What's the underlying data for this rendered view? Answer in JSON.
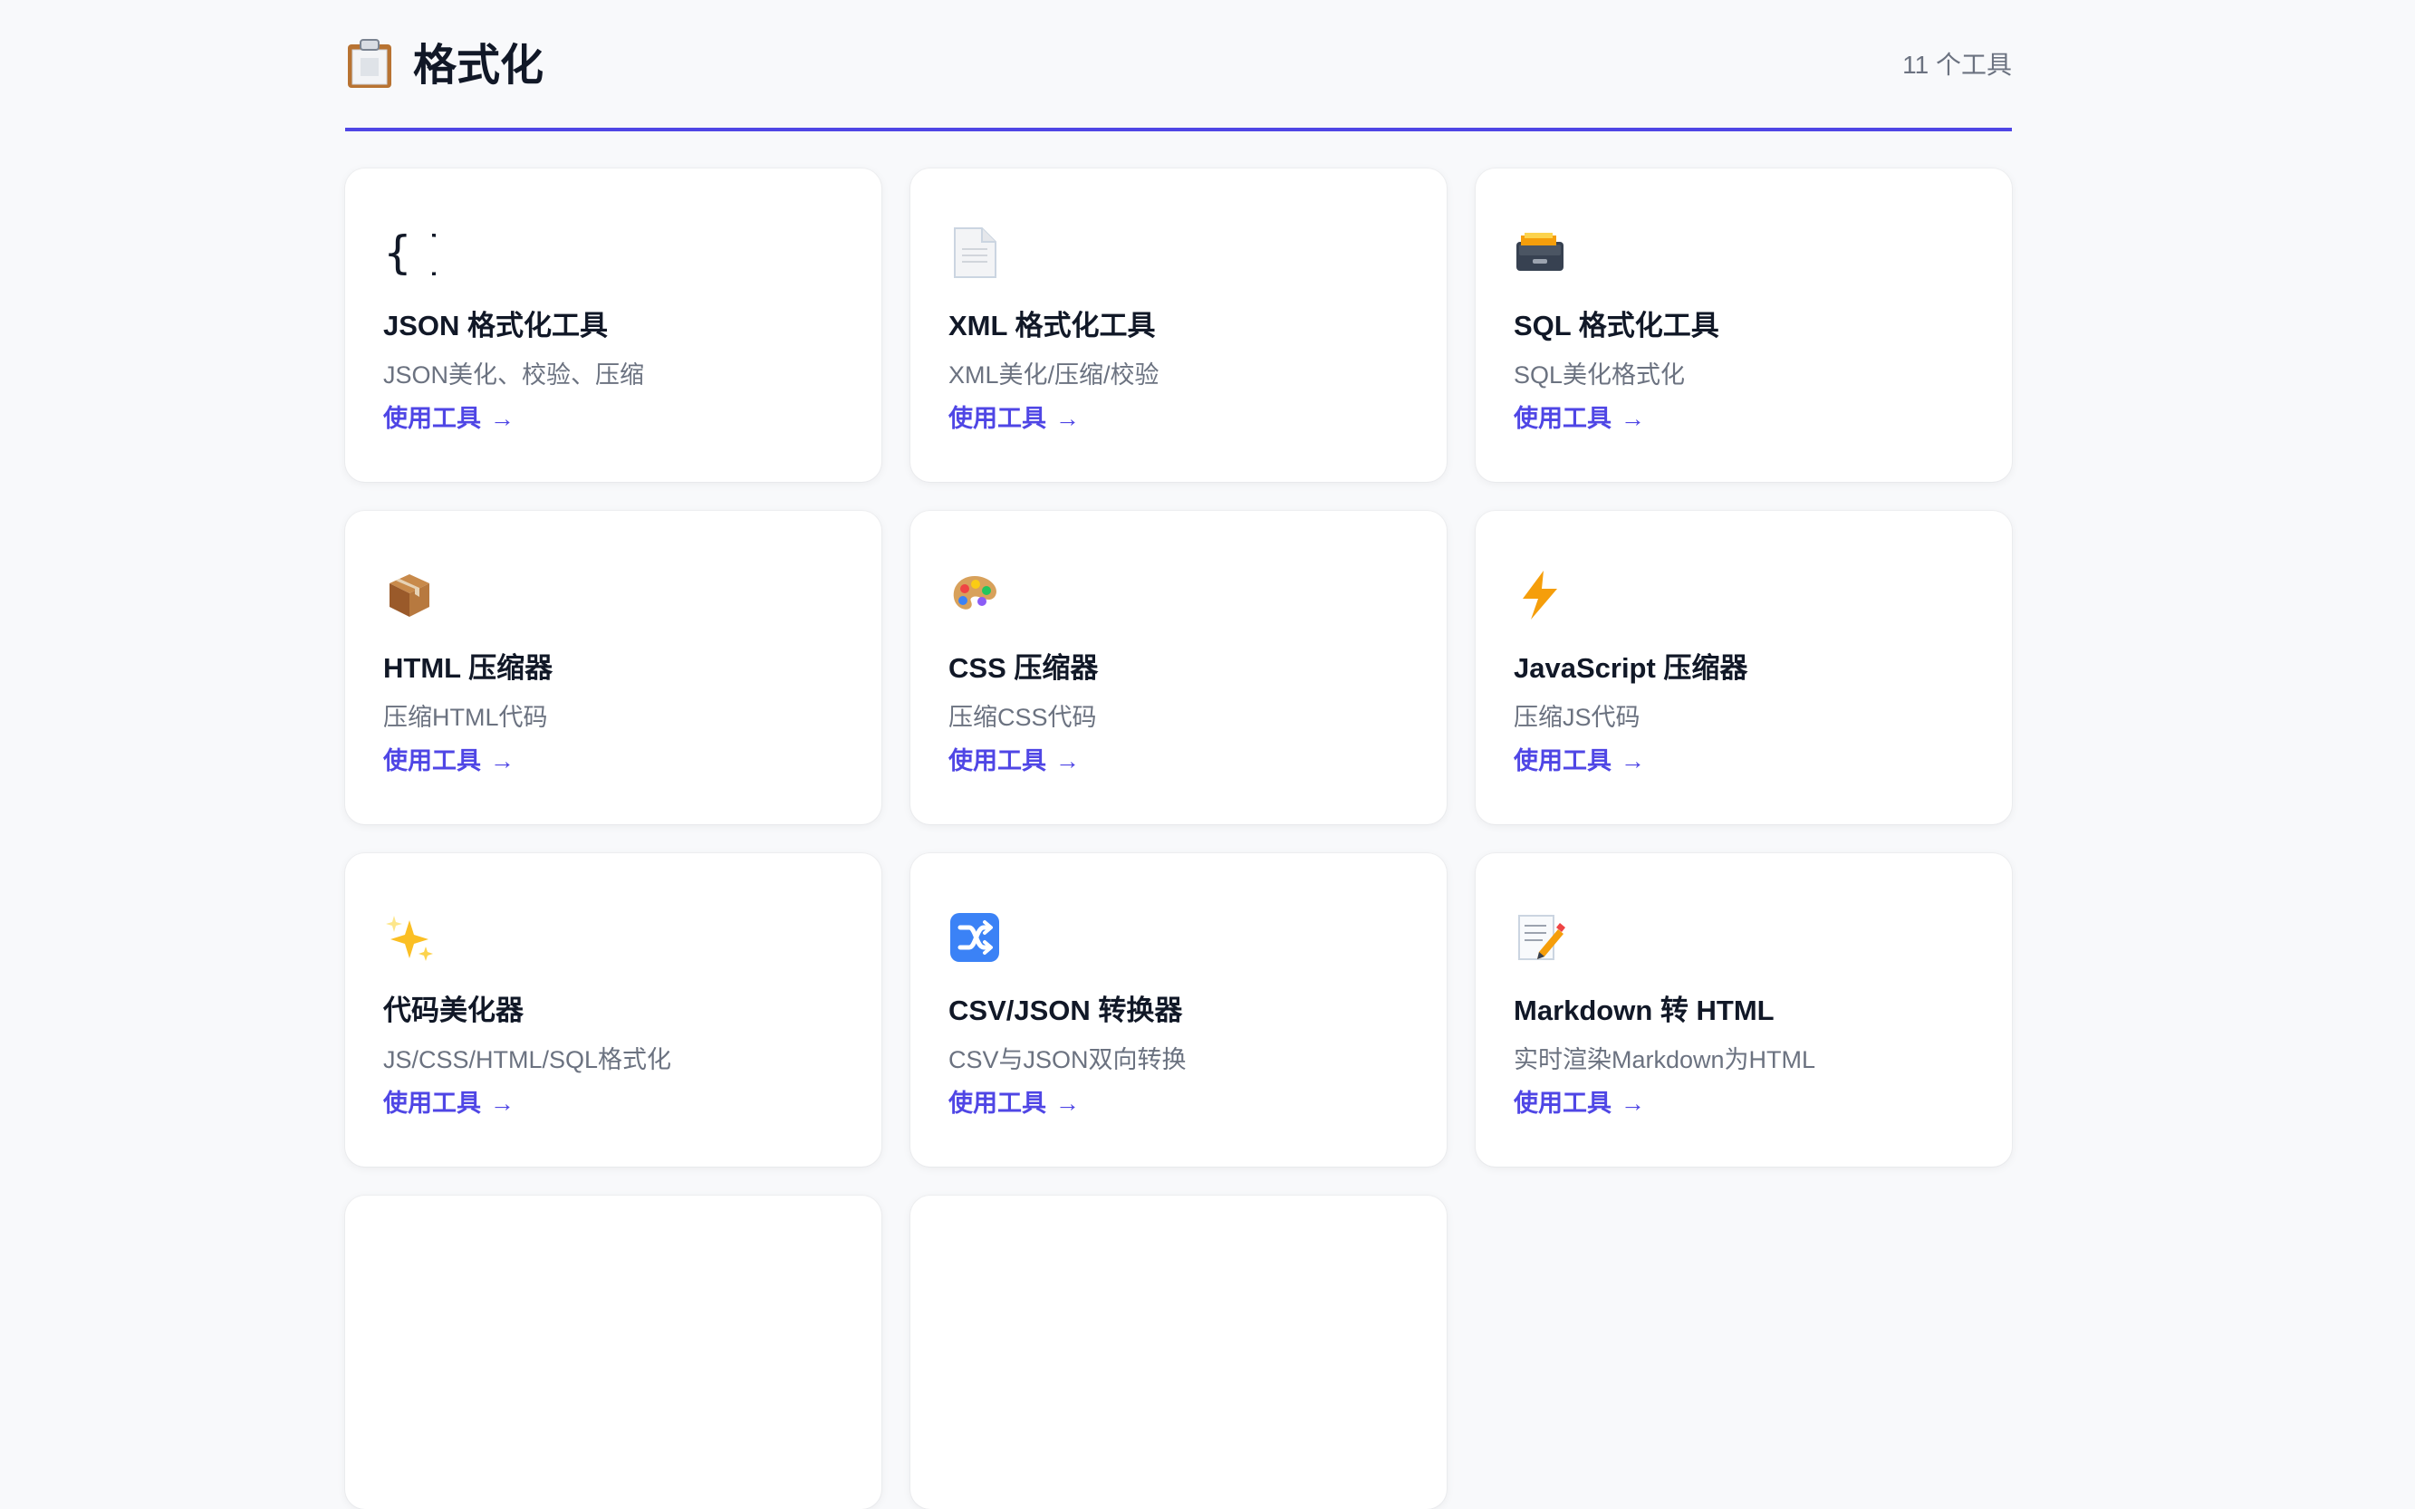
{
  "section": {
    "icon": "clipboard-icon",
    "title": "格式化",
    "count": "11 个工具"
  },
  "tools": [
    {
      "icon": "braces-icon",
      "title": "JSON 格式化工具",
      "description": "JSON美化、校验、压缩",
      "link": "使用工具"
    },
    {
      "icon": "document-icon",
      "title": "XML 格式化工具",
      "description": "XML美化/压缩/校验",
      "link": "使用工具"
    },
    {
      "icon": "file-cabinet-icon",
      "title": "SQL 格式化工具",
      "description": "SQL美化格式化",
      "link": "使用工具"
    },
    {
      "icon": "package-icon",
      "title": "HTML 压缩器",
      "description": "压缩HTML代码",
      "link": "使用工具"
    },
    {
      "icon": "palette-icon",
      "title": "CSS 压缩器",
      "description": "压缩CSS代码",
      "link": "使用工具"
    },
    {
      "icon": "lightning-icon",
      "title": "JavaScript 压缩器",
      "description": "压缩JS代码",
      "link": "使用工具"
    },
    {
      "icon": "sparkles-icon",
      "title": "代码美化器",
      "description": "JS/CSS/HTML/SQL格式化",
      "link": "使用工具"
    },
    {
      "icon": "shuffle-icon",
      "title": "CSV/JSON 转换器",
      "description": "CSV与JSON双向转换",
      "link": "使用工具"
    },
    {
      "icon": "memo-icon",
      "title": "Markdown 转 HTML",
      "description": "实时渲染Markdown为HTML",
      "link": "使用工具"
    }
  ],
  "colors": {
    "accent": "#4f46e5",
    "title": "#111827",
    "muted": "#6b7280",
    "page_background": "#f8f9fb",
    "card_background": "#ffffff"
  }
}
